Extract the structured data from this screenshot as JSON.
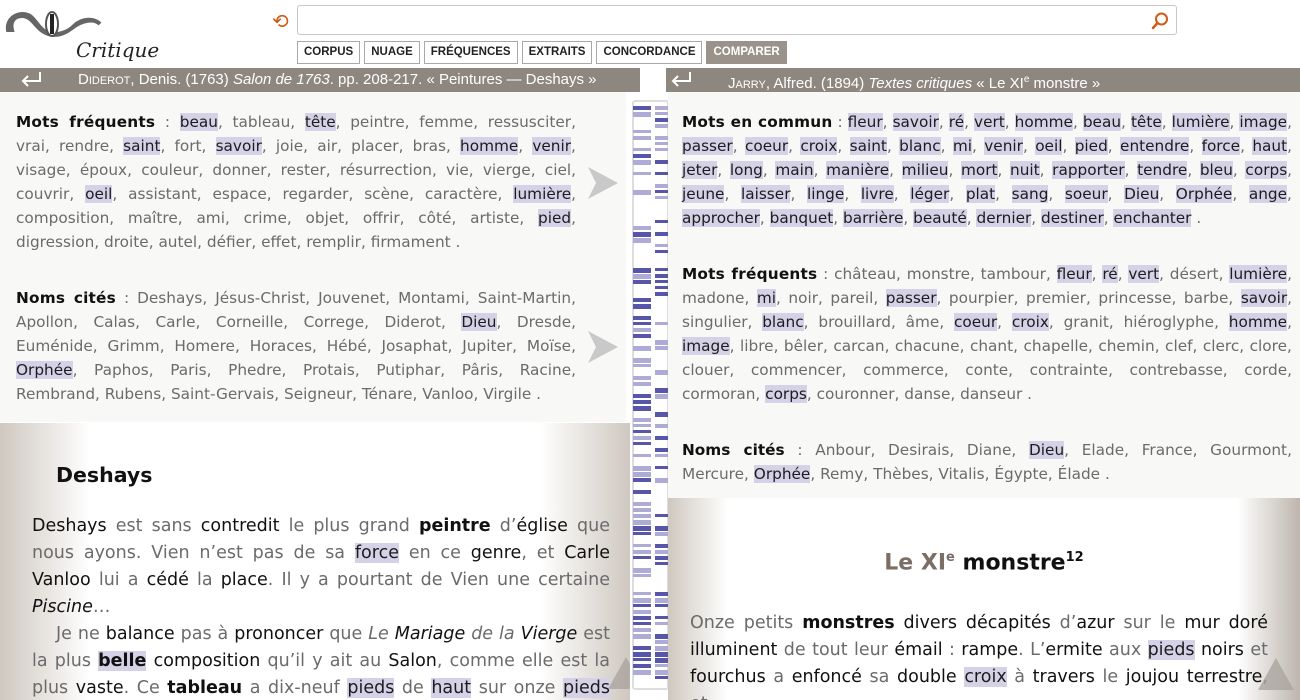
{
  "app": {
    "logo_text": "Critique"
  },
  "search": {
    "placeholder": "",
    "value": ""
  },
  "tabs": [
    "CORPUS",
    "NUAGE",
    "FRÉQUENCES",
    "EXTRAITS",
    "CONCORDANCE",
    "COMPARER"
  ],
  "active_tab": "COMPARER",
  "left": {
    "bar": {
      "author": "Diderot",
      "author_rest": ", Denis. (1763) ",
      "title": "Salon de 1763",
      "rest": ". pp. 208-217. « Peintures — Deshays »"
    },
    "freq_label": "Mots fréquents",
    "freq_words": [
      "beau",
      "tableau",
      "tête",
      "peintre",
      "femme",
      "ressusciter",
      "vrai",
      "rendre",
      "saint",
      "fort",
      "savoir",
      "joie",
      "air",
      "placer",
      "bras",
      "homme",
      "venir",
      "visage",
      "époux",
      "couleur",
      "donner",
      "rester",
      "résurrection",
      "vie",
      "vierge",
      "ciel",
      "couvrir",
      "oeil",
      "assistant",
      "espace",
      "regarder",
      "scène",
      "caractère",
      "lumière",
      "composition",
      "maître",
      "ami",
      "crime",
      "objet",
      "offrir",
      "côté",
      "artiste",
      "pied",
      "digression",
      "droite",
      "autel",
      "défier",
      "effet",
      "remplir",
      "firmament"
    ],
    "freq_hl": [
      "beau",
      "tête",
      "saint",
      "savoir",
      "homme",
      "venir",
      "oeil",
      "lumière",
      "pied"
    ],
    "names_label": "Noms cités",
    "names": [
      "Deshays",
      "Jésus-Christ",
      "Jouvenet",
      "Montami",
      "Saint-Martin",
      "Apollon",
      "Calas",
      "Carle",
      "Corneille",
      "Correge",
      "Diderot",
      "Dieu",
      "Dresde",
      "Euménide",
      "Grimm",
      "Homere",
      "Horaces",
      "Hébé",
      "Josaphat",
      "Jupiter",
      "Moïse",
      "Orphée",
      "Paphos",
      "Paris",
      "Phedre",
      "Protais",
      "Putiphar",
      "Pâris",
      "Racine",
      "Rembrand",
      "Rubens",
      "Saint-Gervais",
      "Seigneur",
      "Ténare",
      "Vanloo",
      "Virgile"
    ],
    "names_hl": [
      "Dieu",
      "Orphée"
    ],
    "heading": "Deshays"
  },
  "right": {
    "bar": {
      "author": "Jarry",
      "author_rest": ", Alfred. (1894) ",
      "title": "Textes critiques",
      "rest_a": " « Le XI",
      "rest_sup": "e",
      "rest_b": " monstre »"
    },
    "common_label": "Mots en commun",
    "common_words": [
      "fleur",
      "savoir",
      "ré",
      "vert",
      "homme",
      "beau",
      "tête",
      "lumière",
      "image",
      "passer",
      "coeur",
      "croix",
      "saint",
      "blanc",
      "mi",
      "venir",
      "oeil",
      "pied",
      "entendre",
      "force",
      "haut",
      "jeter",
      "long",
      "main",
      "manière",
      "milieu",
      "mort",
      "nuit",
      "rapporter",
      "tendre",
      "bleu",
      "corps",
      "jeune",
      "laisser",
      "linge",
      "livre",
      "léger",
      "plat",
      "sang",
      "soeur",
      "Dieu",
      "Orphée",
      "ange",
      "approcher",
      "banquet",
      "barrière",
      "beauté",
      "dernier",
      "destiner",
      "enchanter"
    ],
    "freq_label": "Mots fréquents",
    "freq_words": [
      "château",
      "monstre",
      "tambour",
      "fleur",
      "ré",
      "vert",
      "désert",
      "lumière",
      "madone",
      "mi",
      "noir",
      "pareil",
      "passer",
      "pourpier",
      "premier",
      "princesse",
      "barbe",
      "savoir",
      "singulier",
      "blanc",
      "brouillard",
      "âme",
      "coeur",
      "croix",
      "granit",
      "hiéroglyphe",
      "homme",
      "image",
      "libre",
      "bêler",
      "carcan",
      "chacune",
      "chant",
      "chapelle",
      "chemin",
      "clef",
      "clerc",
      "clore",
      "clouer",
      "commencer",
      "commerce",
      "conte",
      "contrainte",
      "contrebasse",
      "corde",
      "cormoran",
      "corps",
      "couronner",
      "danse",
      "danseur"
    ],
    "freq_hl": [
      "fleur",
      "ré",
      "vert",
      "lumière",
      "mi",
      "passer",
      "savoir",
      "blanc",
      "coeur",
      "croix",
      "homme",
      "image",
      "corps"
    ],
    "names_label": "Noms cités",
    "names": [
      "Anbour",
      "Desirais",
      "Diane",
      "Dieu",
      "Elade",
      "France",
      "Gourmont",
      "Mercure",
      "Orphée",
      "Remy",
      "Thèbes",
      "Vitalis",
      "Égypte",
      "Élade"
    ],
    "names_hl": [
      "Dieu",
      "Orphée"
    ],
    "heading_a": "Le XI",
    "heading_sup": "e",
    "heading_b": " monstre",
    "heading_note": "12"
  },
  "colors": {
    "bar": "#8e8780",
    "highlight": "#d5d2e8",
    "accent": "#d25a14"
  },
  "icons": {
    "reset": "reset-icon",
    "search": "search-icon",
    "back": "return-arrow-icon"
  }
}
